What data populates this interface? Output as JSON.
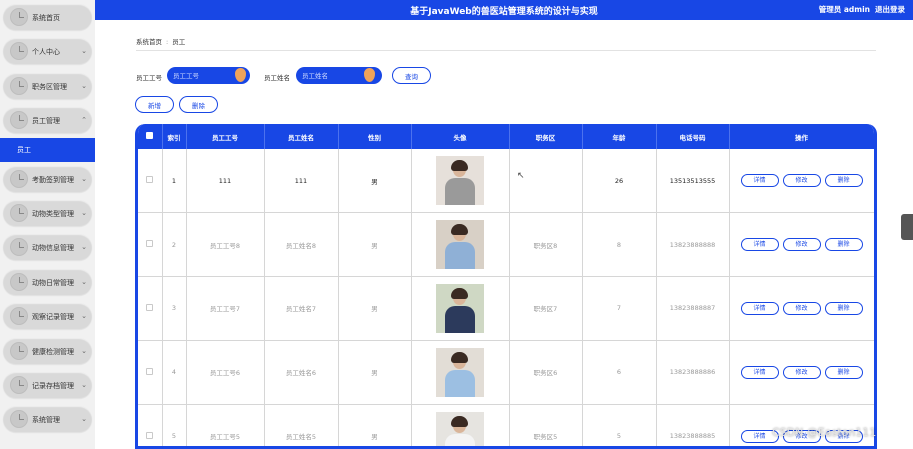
{
  "header": {
    "title": "基于JavaWeb的兽医站管理系统的设计与实现",
    "user": "管理员 admin",
    "logout": "退出登录"
  },
  "sidebar": {
    "items": [
      {
        "label": "系统首页",
        "chevron": ""
      },
      {
        "label": "个人中心",
        "chevron": "⌄"
      },
      {
        "label": "职务区管理",
        "chevron": "⌄"
      },
      {
        "label": "员工管理",
        "chevron": "⌃"
      },
      {
        "label": "考勤签到管理",
        "chevron": "⌄"
      },
      {
        "label": "动物类型管理",
        "chevron": "⌄"
      },
      {
        "label": "动物信息管理",
        "chevron": "⌄"
      },
      {
        "label": "动物日常管理",
        "chevron": "⌄"
      },
      {
        "label": "观察记录管理",
        "chevron": "⌄"
      },
      {
        "label": "健康检测管理",
        "chevron": "⌄"
      },
      {
        "label": "记录存档管理",
        "chevron": "⌄"
      },
      {
        "label": "系统管理",
        "chevron": "⌄"
      }
    ],
    "active_sub": "员工"
  },
  "breadcrumb": {
    "home": "系统首页",
    "sep": ":",
    "current": "员工"
  },
  "search": {
    "id_label": "员工工号",
    "id_placeholder": "员工工号",
    "name_label": "员工姓名",
    "name_placeholder": "员工姓名",
    "query_label": "查询"
  },
  "actions": {
    "add_label": "新增",
    "delete_label": "删除"
  },
  "table": {
    "headers": [
      "索引",
      "员工工号",
      "员工姓名",
      "性别",
      "头像",
      "职务区",
      "年龄",
      "电话号码",
      "操作"
    ],
    "row_buttons": {
      "detail": "详情",
      "edit": "修改",
      "delete": "删除"
    },
    "rows": [
      {
        "index": "1",
        "id": "111",
        "name": "111",
        "gender": "男",
        "area": "",
        "age": "26",
        "phone": "13513513555"
      },
      {
        "index": "2",
        "id": "员工工号8",
        "name": "员工姓名8",
        "gender": "男",
        "area": "职务区8",
        "age": "8",
        "phone": "13823888888"
      },
      {
        "index": "3",
        "id": "员工工号7",
        "name": "员工姓名7",
        "gender": "男",
        "area": "职务区7",
        "age": "7",
        "phone": "13823888887"
      },
      {
        "index": "4",
        "id": "员工工号6",
        "name": "员工姓名6",
        "gender": "男",
        "area": "职务区6",
        "age": "6",
        "phone": "13823888886"
      },
      {
        "index": "5",
        "id": "员工工号5",
        "name": "员工姓名5",
        "gender": "男",
        "area": "职务区5",
        "age": "5",
        "phone": "13823888885"
      }
    ]
  },
  "watermark": "CSDN @Easton111",
  "colors": {
    "accent": "#1847e5",
    "sidebar_bg": "#f1f1f1",
    "pill": "#d9d9d9",
    "drop": "#f0a35a"
  }
}
